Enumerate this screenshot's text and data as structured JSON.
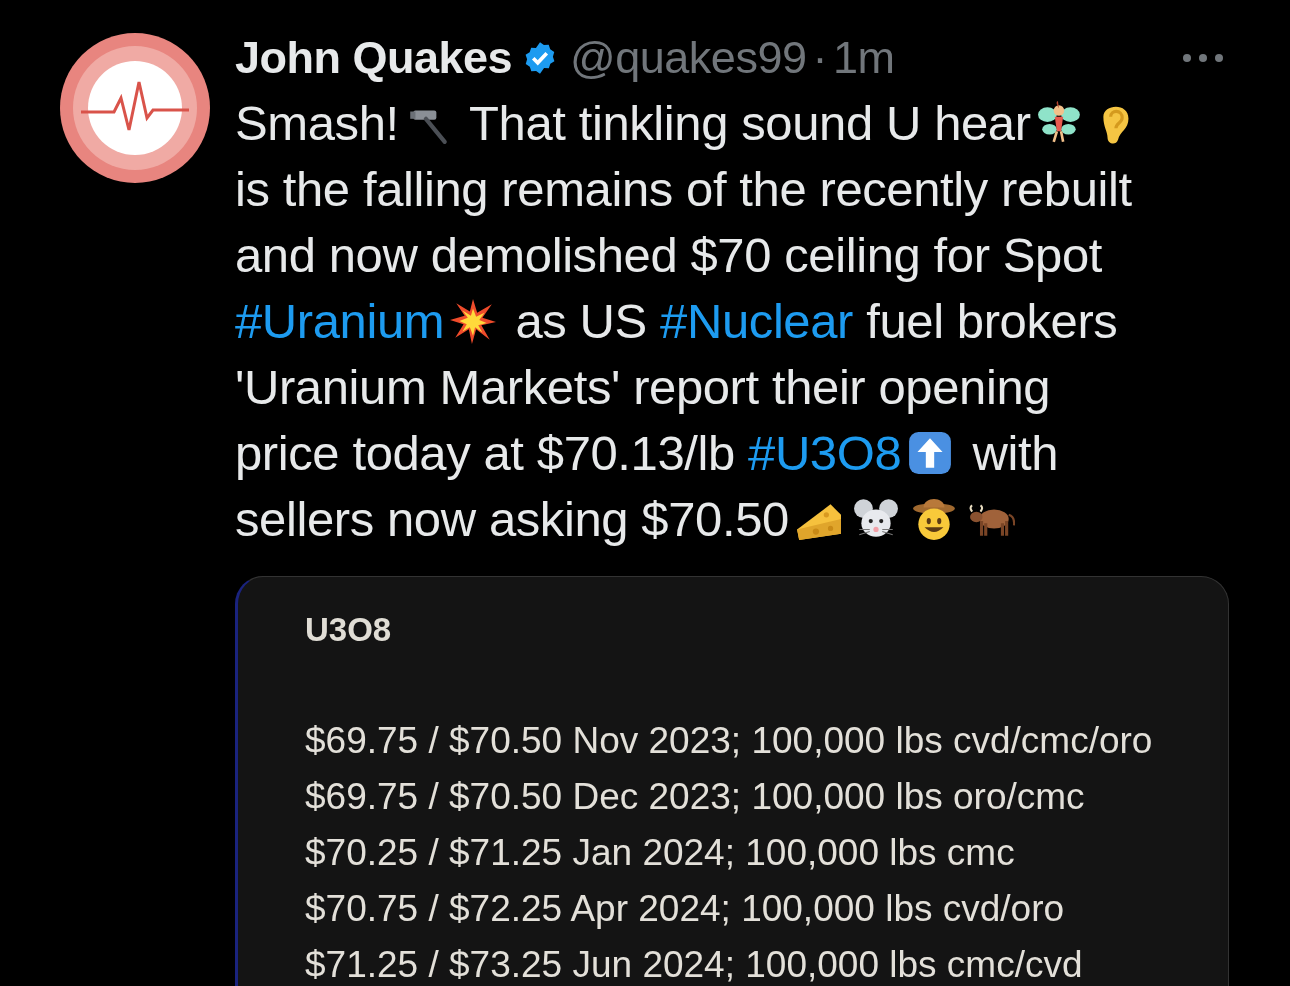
{
  "tweet": {
    "author": {
      "name": "John Quakes",
      "verified": true,
      "handle": "@quakes99",
      "separator": "·",
      "time": "1m"
    },
    "body_lines": [
      [
        {
          "kind": "text",
          "text": "Smash!"
        },
        {
          "kind": "emoji"
        },
        {
          "kind": "text",
          "text": " That tinkling sound U hear"
        },
        {
          "kind": "emoji"
        },
        {
          "kind": "emoji"
        }
      ],
      [
        {
          "kind": "text",
          "text": "is the falling remains of the recently rebuilt"
        }
      ],
      [
        {
          "kind": "text",
          "text": "and now demolished $70 ceiling for Spot"
        }
      ],
      [
        {
          "kind": "hashtag",
          "text": "#Uranium"
        },
        {
          "kind": "emoji"
        },
        {
          "kind": "text",
          "text": " as US "
        },
        {
          "kind": "hashtag",
          "text": "#Nuclear"
        },
        {
          "kind": "text",
          "text": " fuel brokers"
        }
      ],
      [
        {
          "kind": "text",
          "text": "'Uranium Markets' report their opening"
        }
      ],
      [
        {
          "kind": "text",
          "text": "price today at $70.13/lb "
        },
        {
          "kind": "hashtag",
          "text": "#U3O8"
        },
        {
          "kind": "emoji"
        },
        {
          "kind": "text",
          "text": " with"
        }
      ],
      [
        {
          "kind": "text",
          "text": "sellers now asking $70.50"
        },
        {
          "kind": "emoji"
        },
        {
          "kind": "emoji"
        },
        {
          "kind": "emoji"
        },
        {
          "kind": "emoji"
        }
      ]
    ],
    "media": {
      "title": "U3O8",
      "rows": [
        "$69.75 / $70.50 Nov 2023; 100,000 lbs cvd/cmc/oro",
        "$69.75 / $70.50 Dec 2023; 100,000 lbs oro/cmc",
        "$70.25 / $71.25 Jan 2024; 100,000 lbs cmc",
        "$70.75 / $72.25 Apr 2024; 100,000 lbs cvd/oro",
        "$71.25 / $73.25 Jun 2024; 100,000 lbs cmc/cvd"
      ]
    }
  }
}
